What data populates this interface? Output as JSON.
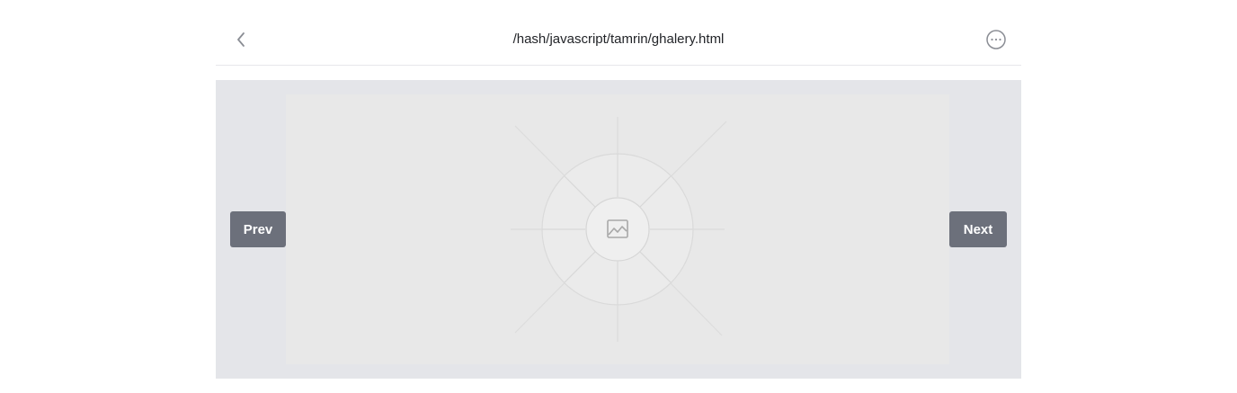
{
  "header": {
    "title": "/hash/javascript/tamrin/ghalery.html",
    "back_icon": "chevron-left-icon",
    "more_icon": "more-horizontal-circle-icon"
  },
  "gallery": {
    "prev_label": "Prev",
    "next_label": "Next",
    "placeholder_icon": "image-icon"
  },
  "colors": {
    "button_bg": "#6c707b",
    "stage_bg": "#e4e5e9",
    "placeholder_bg": "#e8e8e8",
    "divider": "#e6e7ea"
  }
}
